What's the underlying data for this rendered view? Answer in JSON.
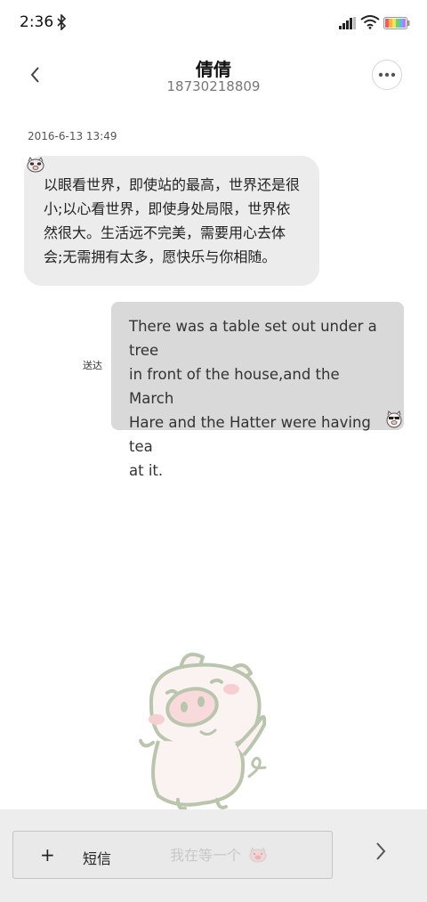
{
  "status_bar": {
    "time": "2:36",
    "icons": [
      "bluetooth-icon",
      "signal-icon",
      "wifi-icon",
      "battery-icon"
    ]
  },
  "header": {
    "back_icon": "chevron-left-icon",
    "contact_name": "倩倩",
    "contact_number": "18730218809",
    "more_icon": "more-horizontal-icon"
  },
  "conversation": {
    "timestamp": "2016-6-13 13:49",
    "messages": [
      {
        "direction": "incoming",
        "lines": [
          "以眼看世界，即使站的最高，世界还是很",
          "小;以心看世界，即使身处局限，世界依",
          "然很大。生活远不完美，需要用心去体",
          "会;无需拥有太多，愿快乐与你相随。"
        ]
      },
      {
        "direction": "outgoing",
        "status": "送达",
        "lines": [
          "There was a table set out under a tree",
          "in front of the house,and the March",
          "Hare and the Hatter were having tea",
          "at it."
        ]
      }
    ]
  },
  "composer": {
    "plus_label": "+",
    "sms_label": "短信",
    "placeholder": "我在等一个",
    "send_icon": "chevron-right-icon"
  },
  "colors": {
    "incoming_bubble": "#ececec",
    "outgoing_bubble": "#d9d9d9",
    "bottom_bar": "#ededed"
  }
}
